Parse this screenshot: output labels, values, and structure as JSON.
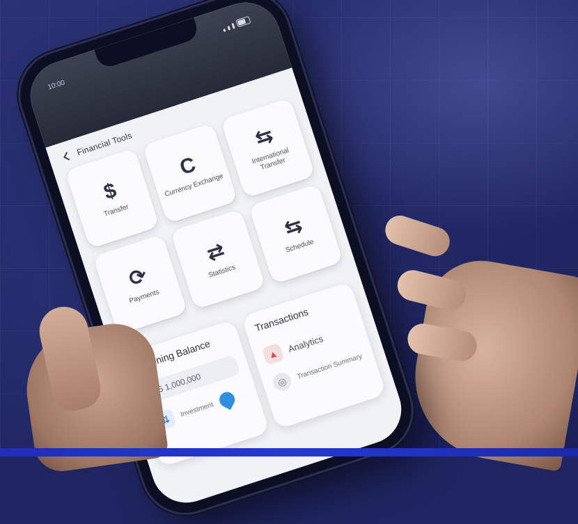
{
  "status_bar": {
    "time": "10:00",
    "icons": [
      "signal-icon",
      "wifi-icon",
      "battery-icon"
    ]
  },
  "nav": {
    "title": "Financial Tools"
  },
  "tiles": [
    {
      "icon": "$",
      "icon_name": "dollar-icon",
      "label": "Transfer"
    },
    {
      "icon": "C",
      "icon_name": "refresh-icon",
      "label": "Currency Exchange"
    },
    {
      "icon": "⇆",
      "icon_name": "exchange-icon",
      "label": "International Transfer"
    },
    {
      "icon": "⟳",
      "icon_name": "recurring-icon",
      "label": "Payments"
    },
    {
      "icon": "⇄",
      "icon_name": "swap-icon",
      "label": "Statistics"
    },
    {
      "icon": "⇆",
      "icon_name": "split-icon",
      "label": "Schedule"
    }
  ],
  "cards": {
    "left": {
      "title": "Opening Balance",
      "amount": "$5 1,000,000",
      "row_label": "Investment"
    },
    "right": {
      "title": "Transactions",
      "row1_label": "Analytics",
      "row2_label": "Transaction Summary"
    }
  },
  "colors": {
    "background": "#242a68",
    "accent_blue": "#2f8ee0",
    "accent_red": "#d94d52",
    "bottom_bar": "#2538d0"
  }
}
